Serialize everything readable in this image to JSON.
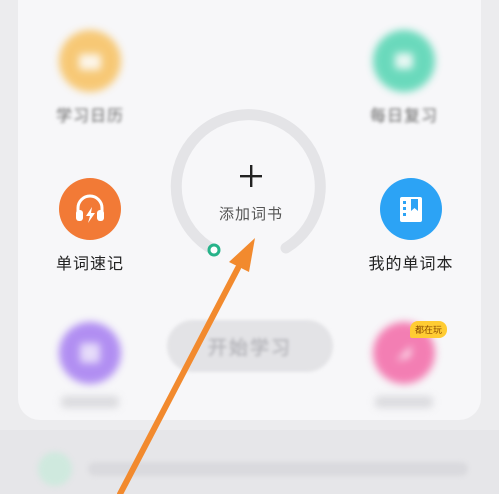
{
  "features": {
    "calendar": {
      "label": "学习日历",
      "icon": "calendar-icon",
      "color": "#f7b94a"
    },
    "review": {
      "label": "每日复习",
      "icon": "review-icon",
      "color": "#3cd0a8"
    },
    "speed_memo": {
      "label": "单词速记",
      "icon": "headphones-icon",
      "color": "#f27a36"
    },
    "my_wordbook": {
      "label": "我的单词本",
      "icon": "book-icon",
      "color": "#2ca3f5"
    },
    "bottom_left": {
      "icon": "letters-icon",
      "color": "#9a6cf0"
    },
    "bottom_right": {
      "icon": "feather-icon",
      "color": "#f2569c",
      "badge": "都在玩"
    }
  },
  "center": {
    "add_label": "添加词书",
    "progress": 0,
    "start_button": "开始学习"
  },
  "accent_color": "#f28a2e"
}
